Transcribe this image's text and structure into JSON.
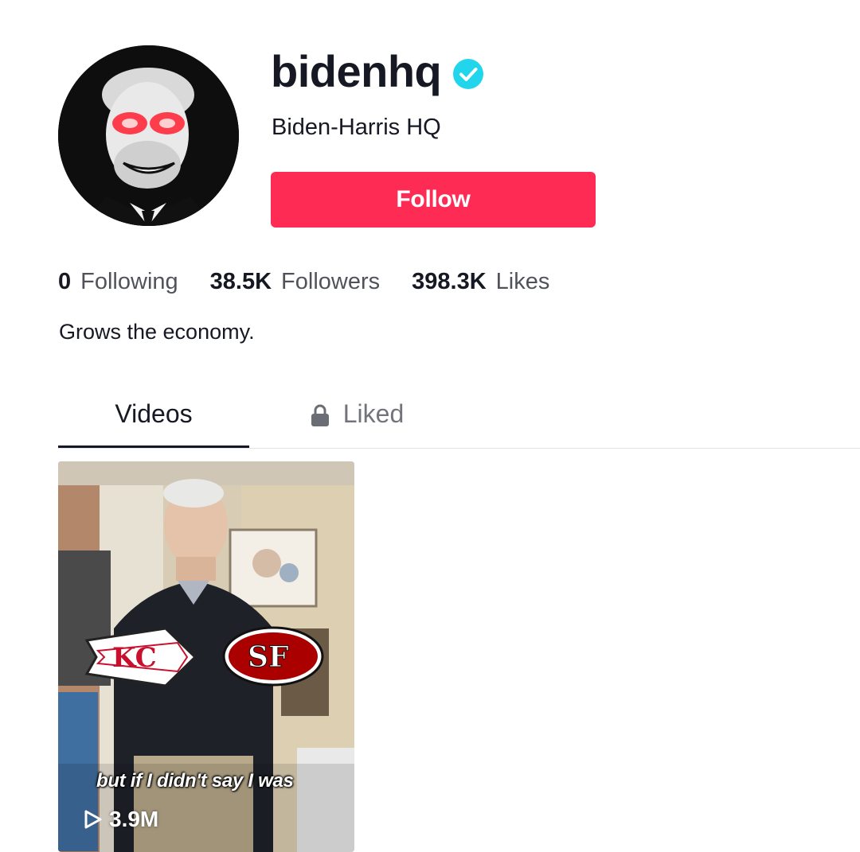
{
  "profile": {
    "username": "bidenhq",
    "nickname": "Biden-Harris HQ",
    "verified": true,
    "follow_label": "Follow",
    "bio": "Grows the economy."
  },
  "stats": {
    "following": {
      "count": "0",
      "label": "Following"
    },
    "followers": {
      "count": "38.5K",
      "label": "Followers"
    },
    "likes": {
      "count": "398.3K",
      "label": "Likes"
    }
  },
  "tabs": {
    "videos": "Videos",
    "liked": "Liked"
  },
  "videos": [
    {
      "caption": "but if I didn't say I was",
      "views": "3.9M"
    }
  ],
  "colors": {
    "follow": "#fe2c55",
    "verified": "#20d5ec",
    "text": "#161823"
  },
  "icons": {
    "verified": "verified-badge-icon",
    "lock": "lock-icon",
    "play": "play-icon"
  }
}
